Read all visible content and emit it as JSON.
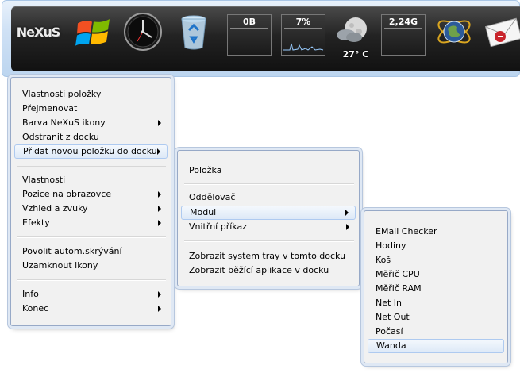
{
  "dock": {
    "items": [
      {
        "icon": "nexus-logo-icon",
        "text": "NeXuS"
      },
      {
        "icon": "windows-logo-icon"
      },
      {
        "icon": "clock-icon"
      },
      {
        "icon": "recycle-bin-icon"
      },
      {
        "icon": "network-in-meter-icon",
        "value": "0B"
      },
      {
        "icon": "cpu-meter-icon",
        "value": "7%"
      },
      {
        "icon": "weather-icon",
        "temperature": "27° C"
      },
      {
        "icon": "network-out-meter-icon",
        "value": "2,24G"
      },
      {
        "icon": "globe-icon"
      },
      {
        "icon": "email-checker-icon"
      }
    ]
  },
  "menu_main": {
    "items": [
      {
        "label": "Vlastnosti položky"
      },
      {
        "label": "Přejmenovat"
      },
      {
        "label": "Barva NeXuS ikony",
        "submenu": true
      },
      {
        "label": "Odstranit z docku"
      },
      {
        "label": "Přidat novou položku do docku",
        "submenu": true,
        "highlighted": true
      },
      {
        "label": "Vlastnosti"
      },
      {
        "label": "Pozice na obrazovce",
        "submenu": true
      },
      {
        "label": "Vzhled a zvuky",
        "submenu": true
      },
      {
        "label": "Efekty",
        "submenu": true
      },
      {
        "label": "Povolit autom.skrývání"
      },
      {
        "label": "Uzamknout ikony"
      },
      {
        "label": "Info",
        "submenu": true
      },
      {
        "label": "Konec",
        "submenu": true
      }
    ]
  },
  "menu_add": {
    "items": [
      {
        "label": "Položka"
      },
      {
        "label": "Oddělovač"
      },
      {
        "label": "Modul",
        "submenu": true,
        "highlighted": true
      },
      {
        "label": "Vnitřní příkaz",
        "submenu": true
      },
      {
        "label": "Zobrazit system tray v tomto docku"
      },
      {
        "label": "Zobrazit běžící aplikace v docku"
      }
    ]
  },
  "menu_module": {
    "items": [
      {
        "label": "EMail Checker"
      },
      {
        "label": "Hodiny"
      },
      {
        "label": "Koš"
      },
      {
        "label": "Měřič CPU"
      },
      {
        "label": "Měřič RAM"
      },
      {
        "label": "Net In"
      },
      {
        "label": "Net Out"
      },
      {
        "label": "Počasí"
      },
      {
        "label": "Wanda",
        "highlighted": true
      }
    ]
  }
}
